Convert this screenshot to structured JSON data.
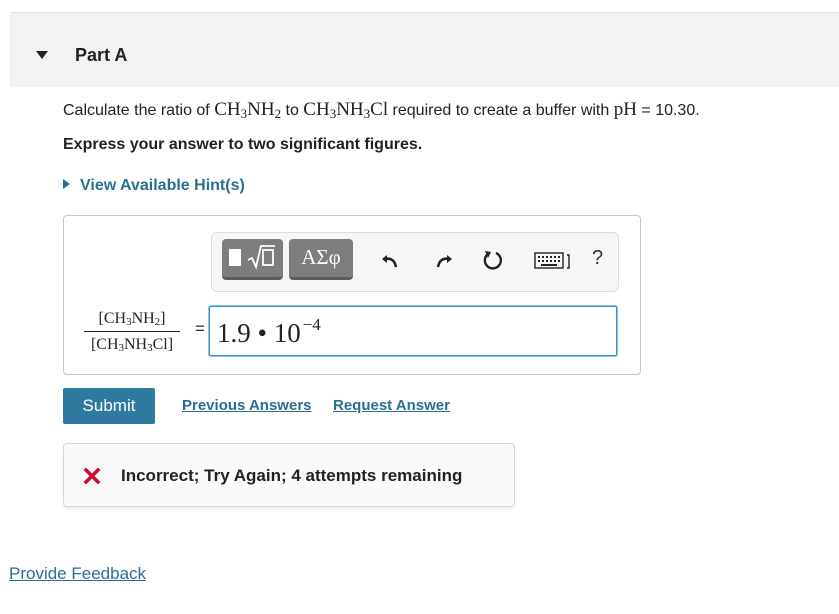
{
  "part": {
    "title": "Part A"
  },
  "question": {
    "text_prefix": "Calculate the ratio of ",
    "species1_a": "CH",
    "species1_sub1": "3",
    "species1_b": "NH",
    "species1_sub2": "2",
    "text_mid": " to ",
    "species2_a": "CH",
    "species2_sub1": "3",
    "species2_b": "NH",
    "species2_sub2": "3",
    "species2_c": "Cl",
    "text_mid2": " required to create a buffer with ",
    "ph_symbol": "pH",
    "text_suffix": " = 10.30.",
    "instruction": "Express your answer to two significant figures."
  },
  "hint": {
    "label": "View Available Hint(s)"
  },
  "toolbar": {
    "greek_label": "ΑΣφ",
    "help_label": "?",
    "icons": [
      "templates-icon",
      "greek-letters-icon",
      "undo-icon",
      "redo-icon",
      "reset-icon",
      "keyboard-icon",
      "help-icon"
    ]
  },
  "fraction": {
    "num_a": "[CH",
    "num_sub1": "3",
    "num_b": "NH",
    "num_sub2": "2",
    "num_c": "]",
    "den_a": "[CH",
    "den_sub1": "3",
    "den_b": "NH",
    "den_sub2": "3",
    "den_c": "Cl]",
    "equals": "="
  },
  "answer": {
    "mantissa": "1.9 • 10",
    "exponent": "−4"
  },
  "actions": {
    "submit": "Submit",
    "previous_answers": "Previous Answers",
    "request_answer": "Request Answer"
  },
  "feedback": {
    "message": "Incorrect; Try Again; 4 attempts remaining",
    "status_color": "#c8102e"
  },
  "footer": {
    "provide_feedback": "Provide Feedback"
  },
  "colors": {
    "accent": "#2f7a9e",
    "link": "#2a6f92",
    "toolbar_button": "#7d7d7d"
  }
}
